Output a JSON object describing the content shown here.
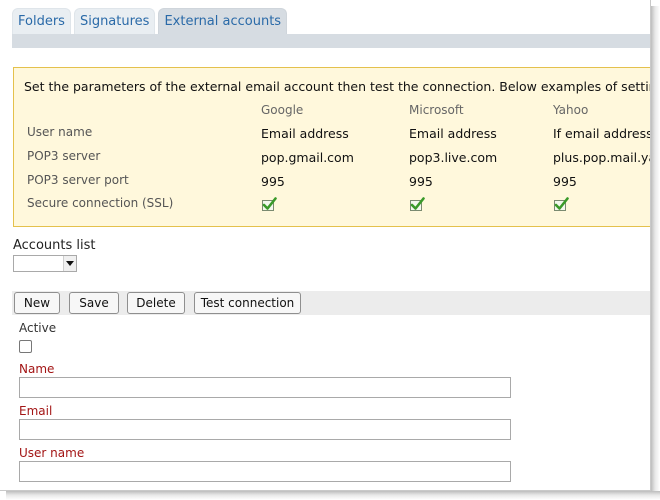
{
  "tabs": [
    {
      "label": "Folders",
      "active": false
    },
    {
      "label": "Signatures",
      "active": false
    },
    {
      "label": "External accounts",
      "active": true
    }
  ],
  "info": {
    "intro": "Set the parameters of the external email account then test the connection. Below examples of settings for so",
    "providers": [
      "Google",
      "Microsoft",
      "Yahoo"
    ],
    "rows": [
      {
        "label": "User name",
        "values": [
          "Email address",
          "Email address",
          "If email address"
        ]
      },
      {
        "label": "POP3 server",
        "values": [
          "pop.gmail.com",
          "pop3.live.com",
          "plus.pop.mail.yah"
        ]
      },
      {
        "label": "POP3 server port",
        "values": [
          "995",
          "995",
          "995"
        ]
      },
      {
        "label": "Secure connection (SSL)",
        "values": [
          "check-icon",
          "check-icon",
          "check-icon"
        ]
      }
    ],
    "colors": {
      "background": "#fff8dc",
      "border": "#e4c14c"
    }
  },
  "accounts": {
    "label": "Accounts list",
    "selected": ""
  },
  "toolbar": {
    "new_label": "New",
    "save_label": "Save",
    "delete_label": "Delete",
    "test_label": "Test connection"
  },
  "form": {
    "active_label": "Active",
    "active_checked": false,
    "name_label": "Name",
    "name_value": "",
    "email_label": "Email",
    "email_value": "",
    "username_label": "User name",
    "username_value": "",
    "required_color": "#a31515"
  }
}
